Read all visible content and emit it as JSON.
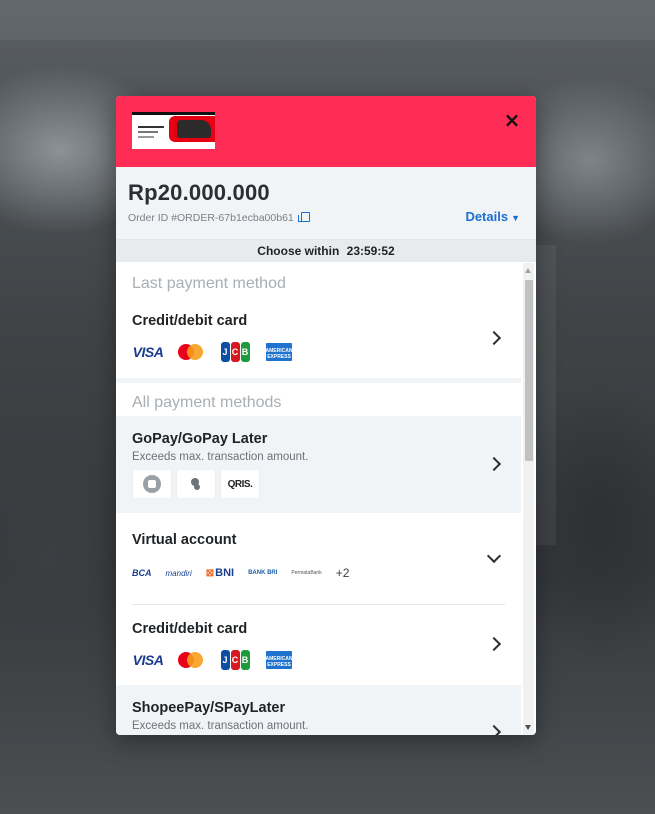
{
  "header": {
    "merchant_logo": "merchant-logo",
    "close_label": "×"
  },
  "summary": {
    "amount": "Rp20.000.000",
    "order_id_label": "Order ID #ORDER-67b1ecba00b61",
    "details_label": "Details"
  },
  "countdown": {
    "prefix": "Choose within",
    "time": "23:59:52"
  },
  "sections": {
    "last_title": "Last payment method",
    "all_title": "All payment methods"
  },
  "last_method": {
    "title": "Credit/debit card",
    "logos": [
      "visa",
      "mastercard",
      "jcb",
      "amex"
    ],
    "visa_label": "VISA",
    "jcb_label": "JCB",
    "amex_label": "AMERICAN EXPRESS"
  },
  "methods": [
    {
      "title": "GoPay/GoPay Later",
      "subtitle": "Exceeds max. transaction amount.",
      "logos": [
        "gopay",
        "gopay-later",
        "qris"
      ],
      "qris_label": "QRIS."
    },
    {
      "title": "Virtual account",
      "banks": [
        "BCA",
        "mandiri",
        "BNI",
        "BANK BRI",
        "PermataBank"
      ],
      "more_label": "+2"
    },
    {
      "title": "Credit/debit card",
      "logos": [
        "visa",
        "mastercard",
        "jcb",
        "amex"
      ]
    },
    {
      "title": "ShopeePay/SPayLater",
      "subtitle": "Exceeds max. transaction amount."
    }
  ],
  "colors": {
    "header": "#ff2d55",
    "link": "#1a6fd4",
    "section_title": "#a9aeb3"
  }
}
